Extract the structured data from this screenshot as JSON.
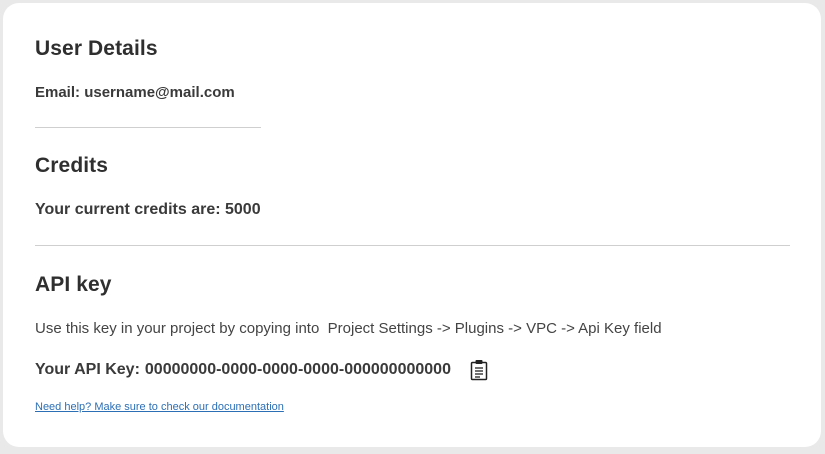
{
  "user_details": {
    "heading": "User Details",
    "email_label": "Email:",
    "email_value": "username@mail.com"
  },
  "credits": {
    "heading": "Credits",
    "text_label": "Your current credits are:",
    "value": "5000"
  },
  "api_key": {
    "heading": "API key",
    "instructions": "Use this key in your project by copying into  Project Settings -> Plugins -> VPC -> Api Key field",
    "key_label": "Your API Key:",
    "key_value": "00000000-0000-0000-0000-000000000000",
    "copy_icon": "clipboard-icon",
    "help_link_text": "Need help? Make sure to check our documentation"
  },
  "colors": {
    "background": "#e9e9e9",
    "card": "#ffffff",
    "link": "#2c6fb5",
    "text": "#333333"
  }
}
